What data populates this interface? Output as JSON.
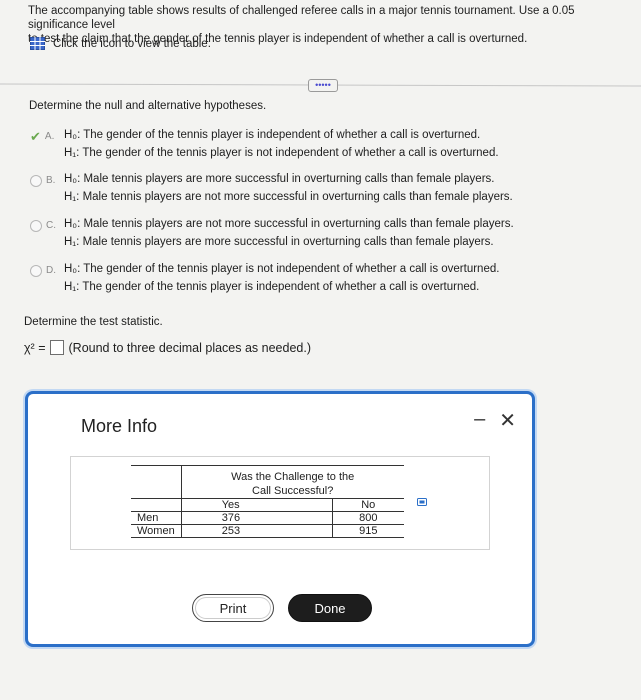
{
  "question": {
    "line1": "The accompanying table shows results of challenged referee calls in a major tennis tournament. Use a 0.05 significance level",
    "line2": "to test the claim that the gender of the tennis player is independent of whether a call is overturned.",
    "view_table": "Click the icon to view the table.",
    "more_button": "•••••"
  },
  "hypotheses": {
    "prompt": "Determine the null and alternative hypotheses.",
    "options": [
      {
        "letter": "A.",
        "h0": "H₀: The gender of the tennis player is independent of whether a call is overturned.",
        "h1": "H₁: The gender of the tennis player is not independent of whether a call is overturned.",
        "selected": true
      },
      {
        "letter": "B.",
        "h0": "H₀: Male tennis players are more successful in overturning calls than female players.",
        "h1": "H₁: Male tennis players are not more successful in overturning calls than female players.",
        "selected": false
      },
      {
        "letter": "C.",
        "h0": "H₀: Male tennis players are not more successful in overturning calls than female players.",
        "h1": "H₁: Male tennis players are more successful in overturning calls than female players.",
        "selected": false
      },
      {
        "letter": "D.",
        "h0": "H₀: The gender of the tennis player is not independent of whether a call is overturned.",
        "h1": "H₁: The gender of the tennis player is independent of whether a call is overturned.",
        "selected": false
      }
    ]
  },
  "test_statistic": {
    "prompt": "Determine the test statistic.",
    "label": "χ² =",
    "value": "",
    "hint": "(Round to three decimal places as needed.)"
  },
  "modal": {
    "title": "More Info",
    "minimize": "–",
    "close": "✕",
    "table": {
      "header_line1": "Was the Challenge to the",
      "header_line2": "Call Successful?",
      "col_yes": "Yes",
      "col_no": "No",
      "rows": [
        {
          "label": "Men",
          "yes": "376",
          "no": "800"
        },
        {
          "label": "Women",
          "yes": "253",
          "no": "915"
        }
      ]
    },
    "print_label": "Print",
    "done_label": "Done"
  },
  "colors": {
    "accent": "#2b6fc8",
    "correct": "#6aa84f",
    "done_bg": "#1d1d1d"
  }
}
